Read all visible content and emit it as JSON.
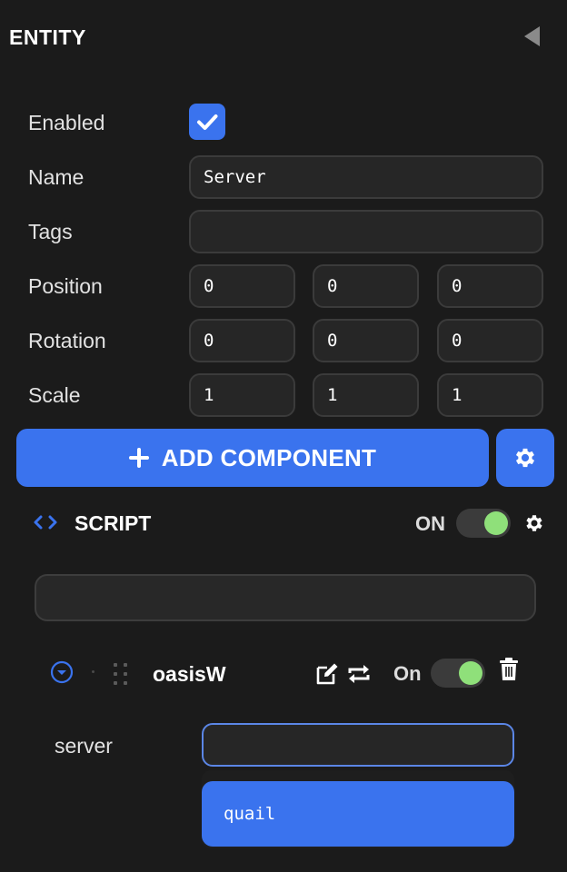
{
  "header": {
    "title": "ENTITY"
  },
  "entity": {
    "enabled_label": "Enabled",
    "enabled": true,
    "name_label": "Name",
    "name_value": "Server",
    "tags_label": "Tags",
    "tags_value": "",
    "position_label": "Position",
    "position": [
      "0",
      "0",
      "0"
    ],
    "rotation_label": "Rotation",
    "rotation": [
      "0",
      "0",
      "0"
    ],
    "scale_label": "Scale",
    "scale": [
      "1",
      "1",
      "1"
    ]
  },
  "toolbar": {
    "add_component_label": "ADD COMPONENT"
  },
  "component": {
    "title": "SCRIPT",
    "state_label": "ON",
    "enabled": true,
    "search_value": ""
  },
  "script": {
    "name": "oasisW",
    "state_label": "On",
    "enabled": true,
    "attribute_label": "server",
    "attribute_value": "",
    "dropdown_options": [
      "quail"
    ]
  },
  "colors": {
    "accent": "#3a73ee",
    "background": "#1b1b1b",
    "field": "#262626",
    "toggle_on_knob": "#8fe07a"
  },
  "icons": {
    "collapse": "triangle-left-icon",
    "check": "check-icon",
    "plus": "plus-icon",
    "gear": "gear-icon",
    "code": "code-brackets-icon",
    "expand": "chevron-down-circle-icon",
    "drag": "drag-handle-icon",
    "edit": "edit-icon",
    "reload": "reload-icon",
    "delete": "trash-icon"
  }
}
